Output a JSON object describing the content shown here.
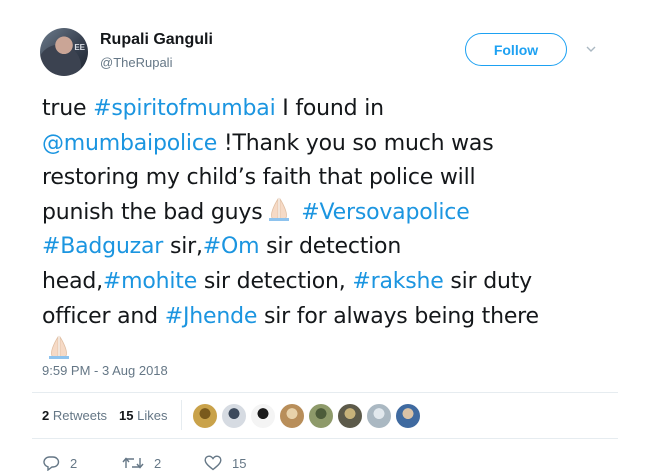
{
  "author": {
    "name": "Rupali Ganguli",
    "handle": "@TheRupali",
    "avatar_text": "EE"
  },
  "follow_label": "Follow",
  "tweet": {
    "segments": [
      [
        {
          "t": "true ",
          "link": false
        },
        {
          "t": "#spiritofmumbai",
          "link": true
        },
        {
          "t": " I found in",
          "link": false
        }
      ],
      [
        {
          "t": "@mumbaipolice",
          "link": true
        },
        {
          "t": " !Thank you so much was",
          "link": false
        }
      ],
      [
        {
          "t": "restoring my child’s faith that police will",
          "link": false
        }
      ],
      [
        {
          "t": "punish the bad guys",
          "link": false
        },
        {
          "emoji": "pray"
        },
        {
          "t": " ",
          "link": false
        },
        {
          "t": "#Versovapolice",
          "link": true
        }
      ],
      [
        {
          "t": "#Badguzar",
          "link": true
        },
        {
          "t": " sir,",
          "link": false
        },
        {
          "t": "#Om",
          "link": true
        },
        {
          "t": " sir detection",
          "link": false
        }
      ],
      [
        {
          "t": "head,",
          "link": false
        },
        {
          "t": "#mohite",
          "link": true
        },
        {
          "t": " sir detection, ",
          "link": false
        },
        {
          "t": "#rakshe",
          "link": true
        },
        {
          "t": " sir duty",
          "link": false
        }
      ],
      [
        {
          "t": "officer and ",
          "link": false
        },
        {
          "t": "#Jhende",
          "link": true
        },
        {
          "t": " sir for always being there",
          "link": false
        }
      ],
      [
        {
          "emoji": "pray"
        }
      ]
    ]
  },
  "timestamp": "9:59 PM - 3 Aug 2018",
  "stats": {
    "retweets_count": "2",
    "retweets_label": "Retweets",
    "likes_count": "15",
    "likes_label": "Likes"
  },
  "likers": [
    {
      "color": "#c9a24a",
      "accent": "#7a5a1c",
      "icon": "avatar-lion"
    },
    {
      "color": "#d6dbe2",
      "accent": "#3d4a5c",
      "icon": "avatar-man-glasses"
    },
    {
      "color": "#f4f4f4",
      "accent": "#1a1a1a",
      "icon": "avatar-emblem"
    },
    {
      "color": "#b88e5a",
      "accent": "#e8d2aa",
      "icon": "avatar-dog"
    },
    {
      "color": "#8e9a6a",
      "accent": "#4d5c3a",
      "icon": "avatar-landscape"
    },
    {
      "color": "#5c5a4a",
      "accent": "#c7b27a",
      "icon": "avatar-dark-portrait"
    },
    {
      "color": "#aab8c2",
      "accent": "#e1e8ed",
      "icon": "avatar-default"
    },
    {
      "color": "#3f6aa0",
      "accent": "#d9c2a6",
      "icon": "avatar-man-blue"
    }
  ],
  "actions": {
    "replies": "2",
    "retweets": "2",
    "likes": "15"
  },
  "colors": {
    "accent": "#1da1f2",
    "link": "#1b95e0",
    "secondary_text": "#657786",
    "divider": "#e6ecf0"
  }
}
